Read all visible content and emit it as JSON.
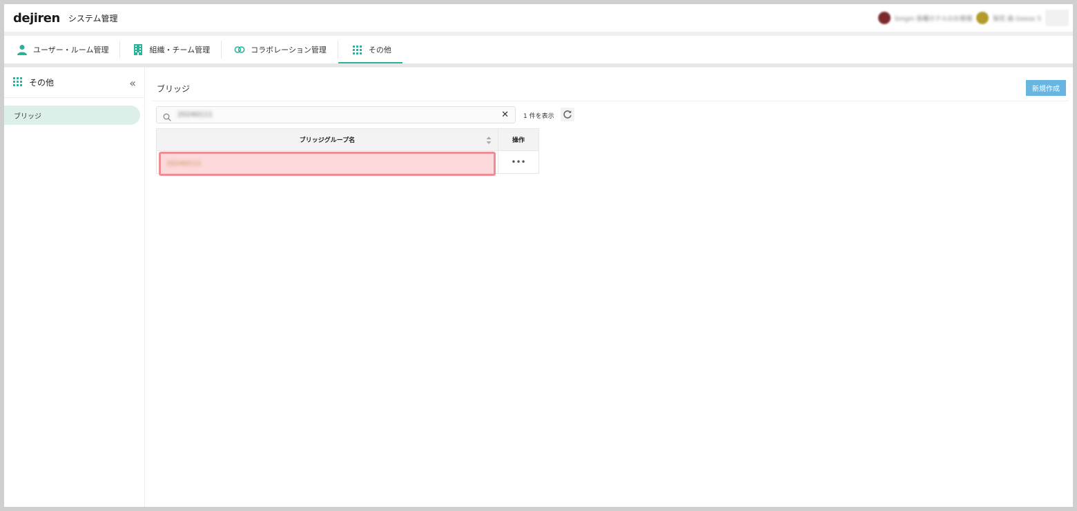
{
  "header": {
    "logo": "dejiren",
    "app_title": "システム管理",
    "user1": "Smgm 各種ホテルのお客様",
    "user2": "梨花 森 Geese 5"
  },
  "tabs": [
    {
      "label": "ユーザー・ルーム管理",
      "icon": "user-icon"
    },
    {
      "label": "組織・チーム管理",
      "icon": "building-icon"
    },
    {
      "label": "コラボレーション管理",
      "icon": "link-icon"
    },
    {
      "label": "その他",
      "icon": "grid-icon",
      "active": true
    }
  ],
  "sidebar": {
    "title": "その他",
    "collapse_glyph": "«",
    "items": [
      {
        "label": "ブリッジ",
        "active": true
      }
    ]
  },
  "main": {
    "title": "ブリッジ",
    "new_button": "新規作成",
    "search_value": "20240111",
    "clear_glyph": "✕",
    "count_text": "1 件を表示"
  },
  "table": {
    "col_name": "ブリッジグループ名",
    "col_op": "操作",
    "rows": [
      {
        "name": "20240111",
        "op": "•••"
      }
    ]
  },
  "colors": {
    "accent": "#2bb29a",
    "button": "#67b5e0",
    "highlight_fill": "#fdd9db",
    "highlight_border": "#ee8b93"
  }
}
